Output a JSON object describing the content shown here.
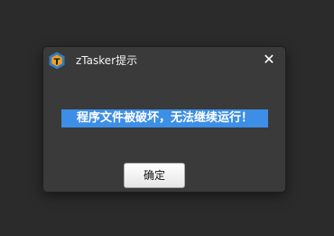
{
  "dialog": {
    "title": "zTasker提示",
    "close_glyph": "✕",
    "message": "程序文件被破坏，无法继续运行！",
    "ok_label": "确定",
    "icon": "ztasker-logo-icon",
    "icon_letter": "T"
  },
  "colors": {
    "background": "#2b2b2b",
    "dialog": "#3a3a3a",
    "selection_highlight": "#3d8ee6",
    "icon_hex": "#2f7dc1",
    "icon_inner": "#f0a020"
  }
}
